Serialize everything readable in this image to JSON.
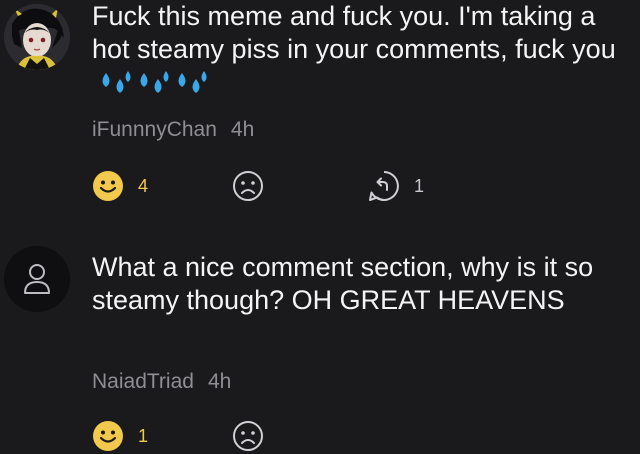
{
  "comments": [
    {
      "text": "Fuck this meme and fuck you. I'm taking a hot steamy piss in your comments, fuck you",
      "emoji": "sweat-droplets-icon x3",
      "username": "iFunnnyChan",
      "time": "4h",
      "smiles": "4",
      "replies": "1"
    },
    {
      "text": "What a nice comment section, why is it so steamy though? OH GREAT HEAVENS",
      "username": "NaiadTriad",
      "time": "4h",
      "smiles": "1"
    }
  ],
  "colors": {
    "background": "#1a1a1c",
    "text": "#f4f4f4",
    "meta": "#8e8e93",
    "smile": "#f2c94c",
    "droplets": "#3aa8e8"
  }
}
